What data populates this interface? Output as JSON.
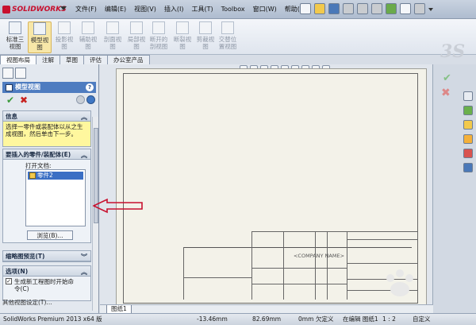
{
  "app": {
    "logo_text": "SOLIDWORKS"
  },
  "menu": [
    "文件(F)",
    "编辑(E)",
    "视图(V)",
    "插入(I)",
    "工具(T)",
    "Toolbox",
    "窗口(W)",
    "帮助(H)"
  ],
  "ribbon": {
    "buttons": [
      {
        "label": "标准三\n视图",
        "state": "normal"
      },
      {
        "label": "模型视\n图",
        "state": "active"
      },
      {
        "label": "投影视\n图",
        "state": "dim"
      },
      {
        "label": "辅助视\n图",
        "state": "dim"
      },
      {
        "label": "剖面视\n图",
        "state": "dim"
      },
      {
        "label": "局部视\n图",
        "state": "dim"
      },
      {
        "label": "断开的\n剖视图",
        "state": "dim"
      },
      {
        "label": "断裂视\n图",
        "state": "dim"
      },
      {
        "label": "剪裁视\n图",
        "state": "dim"
      },
      {
        "label": "交替位\n置视图",
        "state": "dim"
      }
    ]
  },
  "tabs": [
    "视图布局",
    "注解",
    "草图",
    "评估",
    "办公室产品"
  ],
  "property_manager": {
    "title": "模型视图",
    "info": {
      "header": "信息",
      "text": "选择一零件或装配体以从之生成视图，然后单击下一步。"
    },
    "parts": {
      "header": "要插入的零件/装配体(E)",
      "open_docs_label": "打开文档:",
      "items": [
        "零件2"
      ],
      "browse_label": "浏览(B)..."
    },
    "thumbnail": {
      "header": "缩略图预览(T)"
    },
    "options": {
      "header": "选项(N)",
      "checkbox_label": "生成新工程图时开始命令(C)",
      "checked": true
    },
    "truncated_bottom": "其他视图设定(T)..."
  },
  "drawing": {
    "company_name": "<COMPANY NAME>"
  },
  "sheet_tab": "图纸1",
  "status": {
    "product": "SolidWorks Premium 2013 x64 版",
    "x": "-13.46mm",
    "y": "82.69mm",
    "z": "0mm",
    "definition": "欠定义",
    "mode": "在编辑 图纸1",
    "scale": "1 : 2",
    "custom": "自定义"
  },
  "colors": {
    "accent": "#4e7cc0",
    "info_bg": "#fff79e",
    "annotation": "#c8102e"
  }
}
